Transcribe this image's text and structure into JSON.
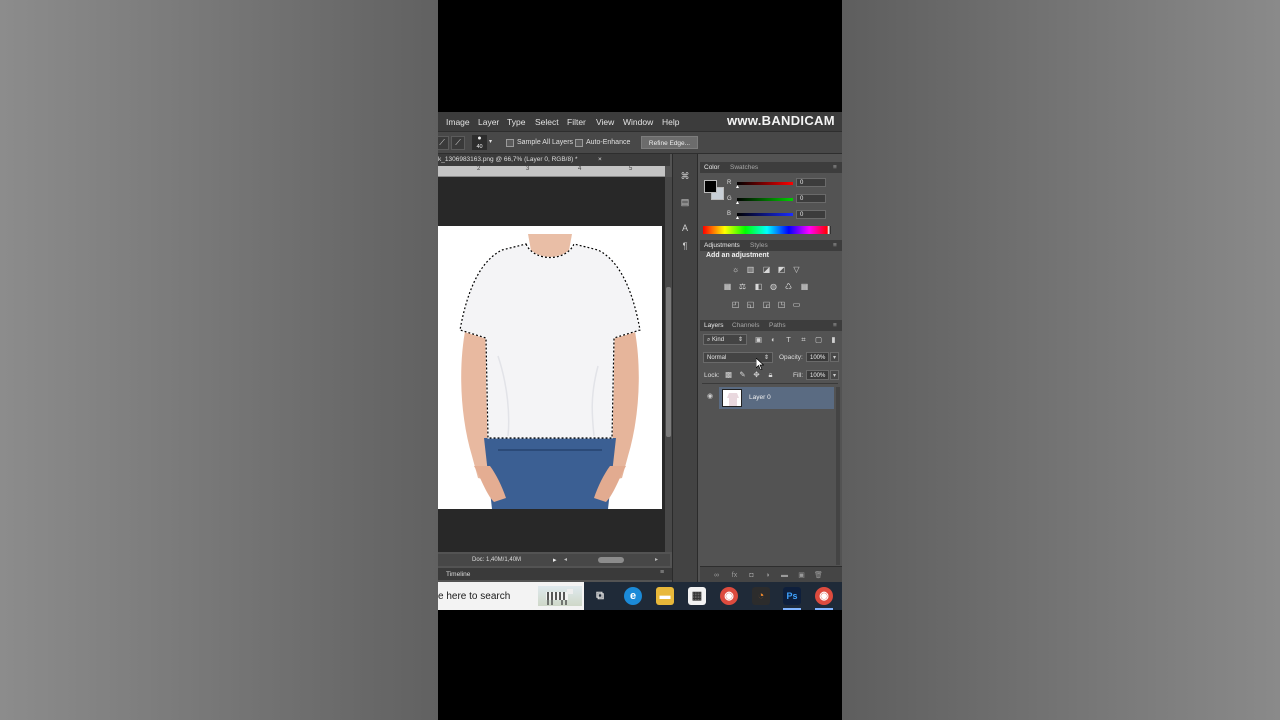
{
  "menu": {
    "items": [
      "Image",
      "Layer",
      "Type",
      "Select",
      "Filter",
      "View",
      "Window",
      "Help"
    ]
  },
  "watermark": "www.BANDICAM",
  "options_bar": {
    "brush_size": "40",
    "sample_all_layers": "Sample All Layers",
    "auto_enhance": "Auto-Enhance",
    "refine_edge": "Refine Edge..."
  },
  "document": {
    "tab_title": "k_1306983163.png @ 66,7% (Layer 0, RGB/8) *",
    "tab_close": "×",
    "ruler_ticks": [
      "2",
      "3",
      "4",
      "5"
    ],
    "status": "Doc: 1,40M/1,40M"
  },
  "timeline": {
    "label": "Timeline"
  },
  "color_panel": {
    "tabs": [
      "Color",
      "Swatches"
    ],
    "channels": [
      {
        "label": "R",
        "value": "0",
        "color": "#e02020"
      },
      {
        "label": "G",
        "value": "0",
        "color": "#20c020"
      },
      {
        "label": "B",
        "value": "0",
        "color": "#2030e0"
      }
    ],
    "foreground": "#000000",
    "background": "#c8cfd6"
  },
  "adjustments_panel": {
    "tabs": [
      "Adjustments",
      "Styles"
    ],
    "title": "Add an adjustment"
  },
  "layers_panel": {
    "tabs": [
      "Layers",
      "Channels",
      "Paths"
    ],
    "kind": "Kind",
    "blend_mode": "Normal",
    "opacity_label": "Opacity:",
    "opacity_value": "100%",
    "lock_label": "Lock:",
    "fill_label": "Fill:",
    "fill_value": "100%",
    "layers": [
      {
        "name": "Layer 0",
        "selected": true
      }
    ]
  },
  "taskbar": {
    "search_text": "e here to search"
  }
}
